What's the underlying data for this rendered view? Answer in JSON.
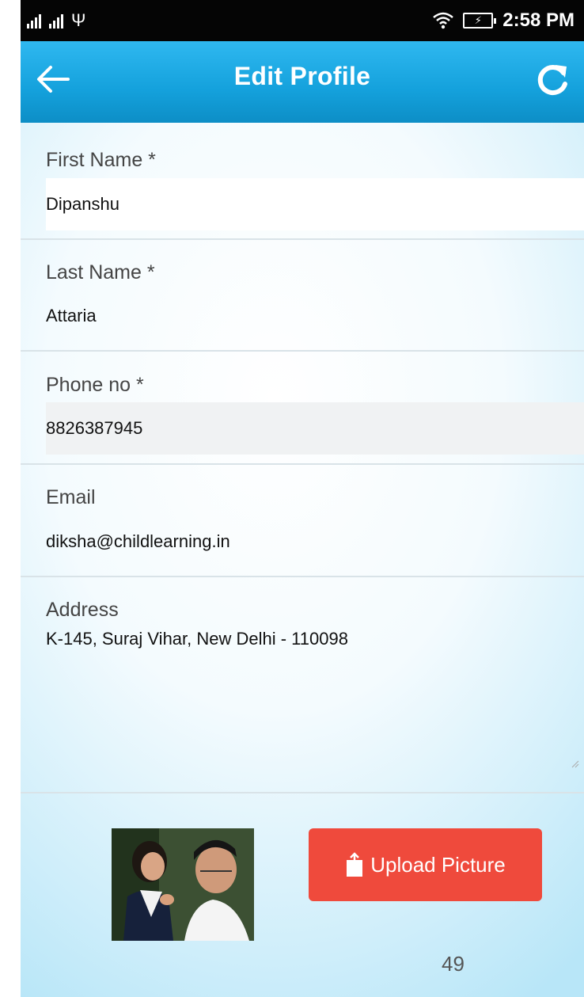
{
  "status_bar": {
    "time": "2:58 PM",
    "icons": [
      "signal-icon",
      "signal-icon",
      "usb-icon",
      "wifi-icon",
      "battery-icon"
    ]
  },
  "app_bar": {
    "title": "Edit Profile",
    "background": "#14a1dc",
    "back_icon": "back-arrow-icon",
    "refresh_icon": "refresh-icon"
  },
  "form": {
    "first_name": {
      "label": "First Name *",
      "value": "Dipanshu"
    },
    "last_name": {
      "label": "Last Name *",
      "value": "Attaria"
    },
    "phone": {
      "label": "Phone no *",
      "value": "8826387945"
    },
    "email": {
      "label": "Email",
      "value": "diksha@childlearning.in"
    },
    "address": {
      "label": "Address",
      "value": "K-145, Suraj Vihar, New Delhi - 110098"
    }
  },
  "upload": {
    "label": "Upload Picture",
    "icon": "upload-icon",
    "color": "#ef4a3c"
  },
  "page_number": "49"
}
